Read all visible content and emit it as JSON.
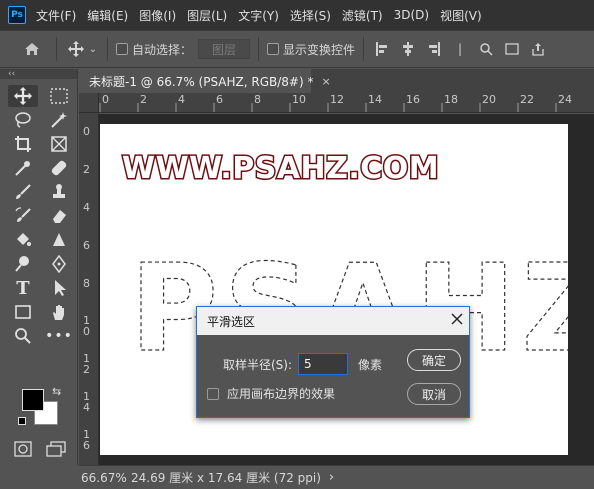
{
  "app": {
    "logo_text": "Ps"
  },
  "menubar": {
    "items": [
      "文件(F)",
      "编辑(E)",
      "图像(I)",
      "图层(L)",
      "文字(Y)",
      "选择(S)",
      "滤镜(T)",
      "3D(D)",
      "视图(V)"
    ]
  },
  "options": {
    "auto_select_label": "自动选择：",
    "layer_dropdown": "图层",
    "show_transform_label": "显示变换控件"
  },
  "document": {
    "tab_title": "未标题-1 @ 66.7% (PSAHZ, RGB/8#) *",
    "close_glyph": "×"
  },
  "rulers": {
    "top_ticks": [
      "0",
      "2",
      "4",
      "6",
      "8",
      "10",
      "12",
      "14",
      "16",
      "18",
      "20",
      "22",
      "24"
    ],
    "left_ticks": [
      "0",
      "2",
      "4",
      "6",
      "8",
      "1 0",
      "1 2",
      "1 4",
      "1 6"
    ]
  },
  "canvas": {
    "watermark_text": "WWW.PSAHZ.COM",
    "selection_text": "PSAHZ",
    "watermark_color": "#6b1010"
  },
  "status": {
    "zoom": "66.67%",
    "doc_size": "24.69 厘米 x 17.64 厘米 (72 ppi)",
    "arrow": "›"
  },
  "dialog": {
    "title": "平滑选区",
    "radius_label": "取样半径(S):",
    "radius_value": "5",
    "unit": "像素",
    "ok_label": "确定",
    "cancel_label": "取消",
    "canvas_edge_label": "应用画布边界的效果"
  },
  "toolbox": {
    "collapse_glyph": "‹‹"
  }
}
